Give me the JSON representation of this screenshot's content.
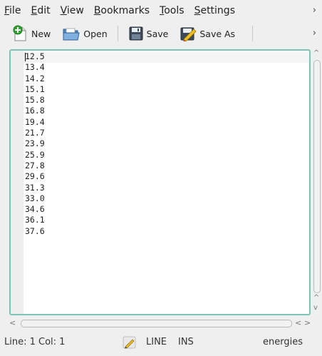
{
  "menu": {
    "items": [
      {
        "label": "File",
        "accel": "F",
        "rest": "ile"
      },
      {
        "label": "Edit",
        "accel": "E",
        "rest": "dit"
      },
      {
        "label": "View",
        "accel": "V",
        "rest": "iew"
      },
      {
        "label": "Bookmarks",
        "accel": "B",
        "rest": "ookmarks"
      },
      {
        "label": "Tools",
        "accel": "T",
        "rest": "ools"
      },
      {
        "label": "Settings",
        "accel": "S",
        "rest": "ettings"
      }
    ],
    "overflow": "›"
  },
  "toolbar": {
    "new_label": "New",
    "open_label": "Open",
    "save_label": "Save",
    "save_as_label": "Save As",
    "overflow": "›",
    "icons": {
      "new": "new-document-icon",
      "open": "open-folder-icon",
      "save": "floppy-disk-icon",
      "save_as": "save-as-pencil-icon"
    }
  },
  "editor": {
    "lines": [
      "12.5",
      "13.4",
      "14.2",
      "15.1",
      "15.8",
      "16.8",
      "19.4",
      "21.7",
      "23.9",
      "25.9",
      "27.8",
      "29.6",
      "31.3",
      "33.0",
      "34.6",
      "36.1",
      "37.6"
    ],
    "border_color": "#7fc3b4"
  },
  "status": {
    "position": "Line: 1 Col: 1",
    "mode": "LINE",
    "insert": "INS",
    "encoding": "energies"
  }
}
